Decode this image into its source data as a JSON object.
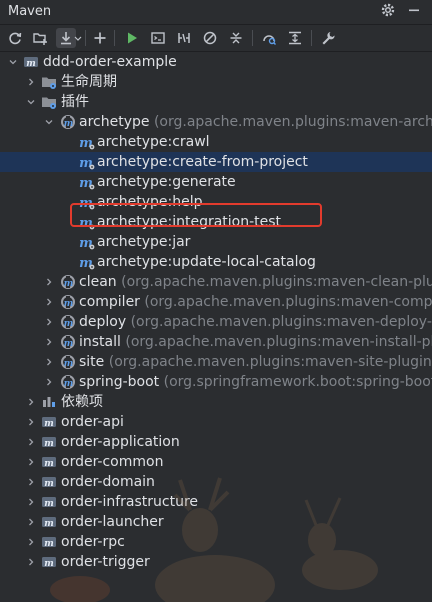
{
  "panel": {
    "title": "Maven"
  },
  "toolbar": {
    "tools": [
      "reload-icon",
      "add-folder-icon",
      "download-icon",
      "plus-icon",
      "run-icon",
      "console-icon",
      "toggle-offline-icon",
      "skip-tests-icon",
      "collapse-icon",
      "analyze-icon",
      "show-deps-icon",
      "settings-wrench-icon"
    ]
  },
  "tree": {
    "project": "ddd-order-example",
    "lifecycle": "生命周期",
    "plugins": "插件",
    "archetype": {
      "name": "archetype",
      "coord": "(org.apache.maven.plugins:maven-archetype",
      "goals": [
        "archetype:crawl",
        "archetype:create-from-project",
        "archetype:generate",
        "archetype:help",
        "archetype:integration-test",
        "archetype:jar",
        "archetype:update-local-catalog"
      ]
    },
    "other_plugins": [
      {
        "name": "clean",
        "coord": "(org.apache.maven.plugins:maven-clean-plugi"
      },
      {
        "name": "compiler",
        "coord": "(org.apache.maven.plugins:maven-compiler"
      },
      {
        "name": "deploy",
        "coord": "(org.apache.maven.plugins:maven-deploy-plu"
      },
      {
        "name": "install",
        "coord": "(org.apache.maven.plugins:maven-install-plug"
      },
      {
        "name": "site",
        "coord": "(org.apache.maven.plugins:maven-site-plugin:3."
      },
      {
        "name": "spring-boot",
        "coord": "(org.springframework.boot:spring-boot-"
      }
    ],
    "dependencies": "依赖项",
    "modules": [
      "order-api",
      "order-application",
      "order-common",
      "order-domain",
      "order-infrastructure",
      "order-launcher",
      "order-rpc",
      "order-trigger"
    ]
  },
  "colors": {
    "background": "#2b2d30",
    "selection": "#1e3457",
    "highlight_box": "#e23b2d",
    "maven_blue": "#5f9ee8",
    "run_green": "#5fb865"
  }
}
